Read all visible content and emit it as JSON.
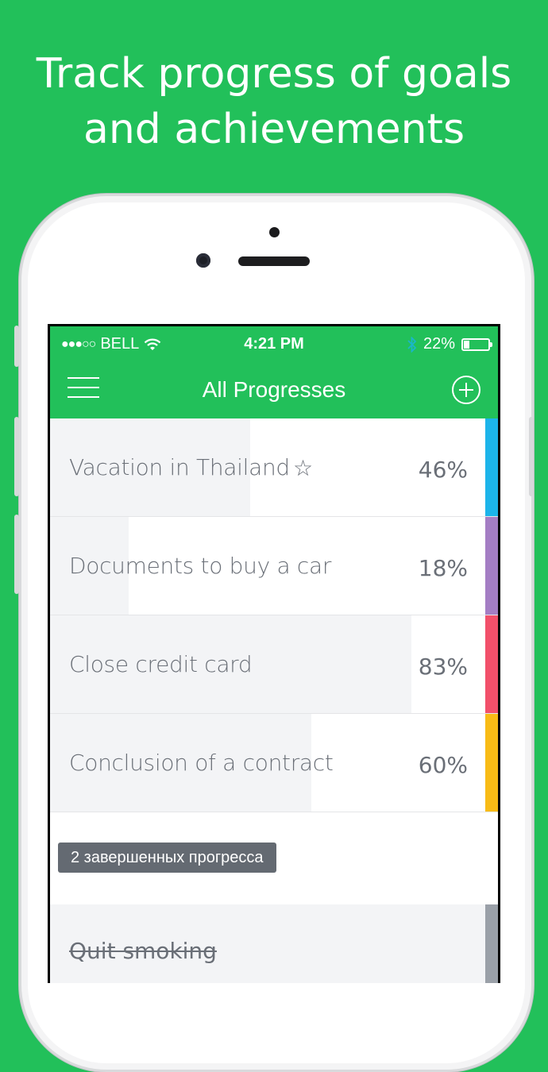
{
  "headline": {
    "line1": "Track progress of goals",
    "line2": "and achievements"
  },
  "status_bar": {
    "signal": "●●●○○",
    "carrier": "BELL",
    "time": "4:21 PM",
    "battery_text": "22%",
    "battery_level": 0.22
  },
  "nav": {
    "title": "All Progresses"
  },
  "progresses": [
    {
      "name": "Vacation in Thailand",
      "percent_label": "46%",
      "percent": 46,
      "starred": true,
      "star": "☆",
      "color": "#1cb4ea"
    },
    {
      "name": "Documents to buy a car",
      "percent_label": "18%",
      "percent": 18,
      "starred": false,
      "color": "#a47ec4"
    },
    {
      "name": "Close credit card",
      "percent_label": "83%",
      "percent": 83,
      "starred": false,
      "color": "#f2506a"
    },
    {
      "name": "Conclusion of a contract",
      "percent_label": "60%",
      "percent": 60,
      "starred": false,
      "color": "#f8bb16"
    }
  ],
  "completed": {
    "badge": "2 завершенных прогресса",
    "items": [
      {
        "name": "Quit smoking",
        "color": "#9aa0a8"
      }
    ]
  },
  "colors": {
    "brand_green": "#22c05a",
    "text_gray": "#6a6f77"
  }
}
